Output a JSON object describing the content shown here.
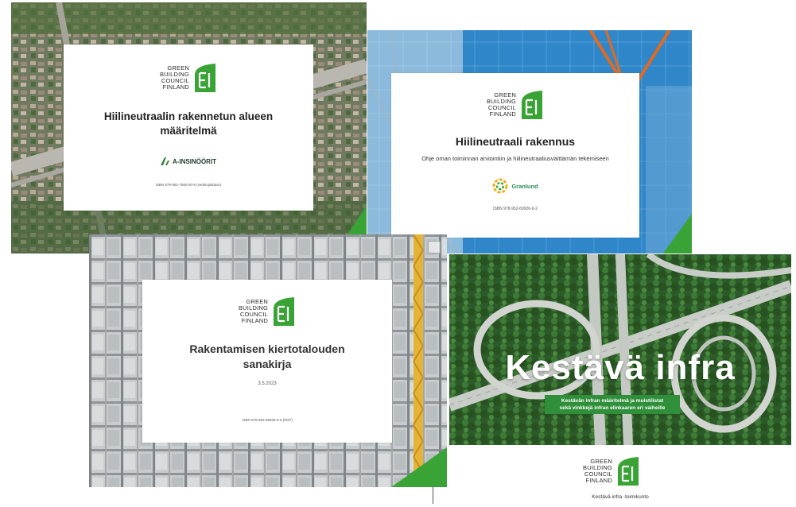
{
  "logo": {
    "lines": [
      "GREEN",
      "BUILDING",
      "COUNCIL",
      "FINLAND"
    ],
    "mark_color": "#3aa335",
    "icon": "gbc-leaf-icon"
  },
  "covers": {
    "c1": {
      "title_line1": "Hiilineutraalin rakennetun alueen",
      "title_line2": "määritelmä",
      "publisher": "A-INSINÖÖRIT",
      "isbn": "ISBN 978-952-7560-00-9 (verkkojulkaisu)"
    },
    "c2": {
      "title": "Hiilineutraali rakennus",
      "subtitle": "Ohje oman toiminnan arviointiin ja hiilineutraaliusväittämän tekemiseen",
      "partner": "Granlund",
      "isbn": "ISBN 978-952-69926-6-2"
    },
    "c3": {
      "title_line1": "Rakentamisen kiertotalouden",
      "title_line2": "sanakirja",
      "date": "3.5.2023",
      "isbn": "ISBN 978-952-69926-8-6 (PDF)"
    },
    "c4": {
      "title": "Kestävä infra",
      "banner_line1": "Kestävän infran määritelmä ja muistilistat",
      "banner_line2": "sekä vinkkejä infran elinkaaren eri vaiheille",
      "footer": "Kestävä infra -toimikunto"
    }
  },
  "colors": {
    "green_accent": "#3aa335",
    "banner_green": "#2f8f3a"
  }
}
